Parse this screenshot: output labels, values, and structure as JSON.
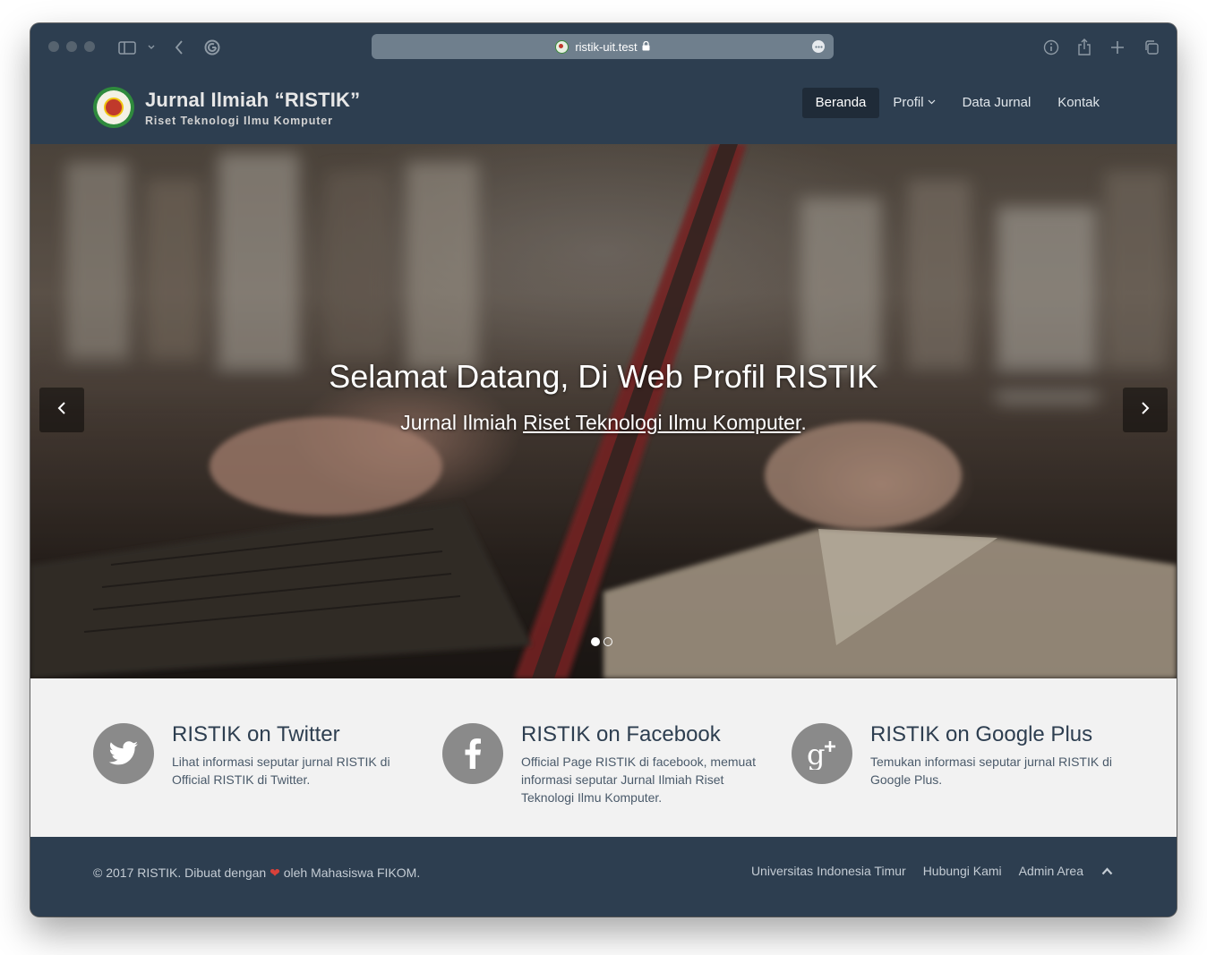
{
  "browser": {
    "url": "ristik-uit.test"
  },
  "brand": {
    "title": "Jurnal Ilmiah “RISTIK”",
    "subtitle": "Riset Teknologi Ilmu Komputer"
  },
  "nav": {
    "items": [
      {
        "label": "Beranda",
        "active": true
      },
      {
        "label": "Profil",
        "dropdown": true
      },
      {
        "label": "Data Jurnal"
      },
      {
        "label": "Kontak"
      }
    ]
  },
  "hero": {
    "title": "Selamat Datang, Di Web Profil RISTIK",
    "subtitle_prefix": "Jurnal Ilmiah ",
    "subtitle_link": "Riset Teknologi Ilmu Komputer",
    "subtitle_suffix": ".",
    "slides_total": 2,
    "active_slide": 1
  },
  "social": [
    {
      "icon": "twitter-icon",
      "title": "RISTIK on Twitter",
      "desc": "Lihat informasi seputar jurnal RISTIK di Official RISTIK di Twitter."
    },
    {
      "icon": "facebook-icon",
      "title": "RISTIK on Facebook",
      "desc": "Official Page RISTIK di facebook, memuat informasi seputar Jurnal Ilmiah Riset Teknologi Ilmu Komputer."
    },
    {
      "icon": "google-plus-icon",
      "title": "RISTIK on Google Plus",
      "desc": "Temukan informasi seputar jurnal RISTIK di Google Plus."
    }
  ],
  "footer": {
    "copy_prefix": "© 2017 RISTIK. Dibuat dengan ",
    "copy_suffix": " oleh Mahasiswa FIKOM.",
    "links": [
      "Universitas Indonesia Timur",
      "Hubungi Kami",
      "Admin Area"
    ]
  },
  "colors": {
    "navbar_bg": "#2d3e50",
    "nav_active_bg": "#1f2b38",
    "social_bg": "#f2f2f2",
    "social_icon_bg": "#8a8a8a",
    "heart": "#d9413a"
  }
}
